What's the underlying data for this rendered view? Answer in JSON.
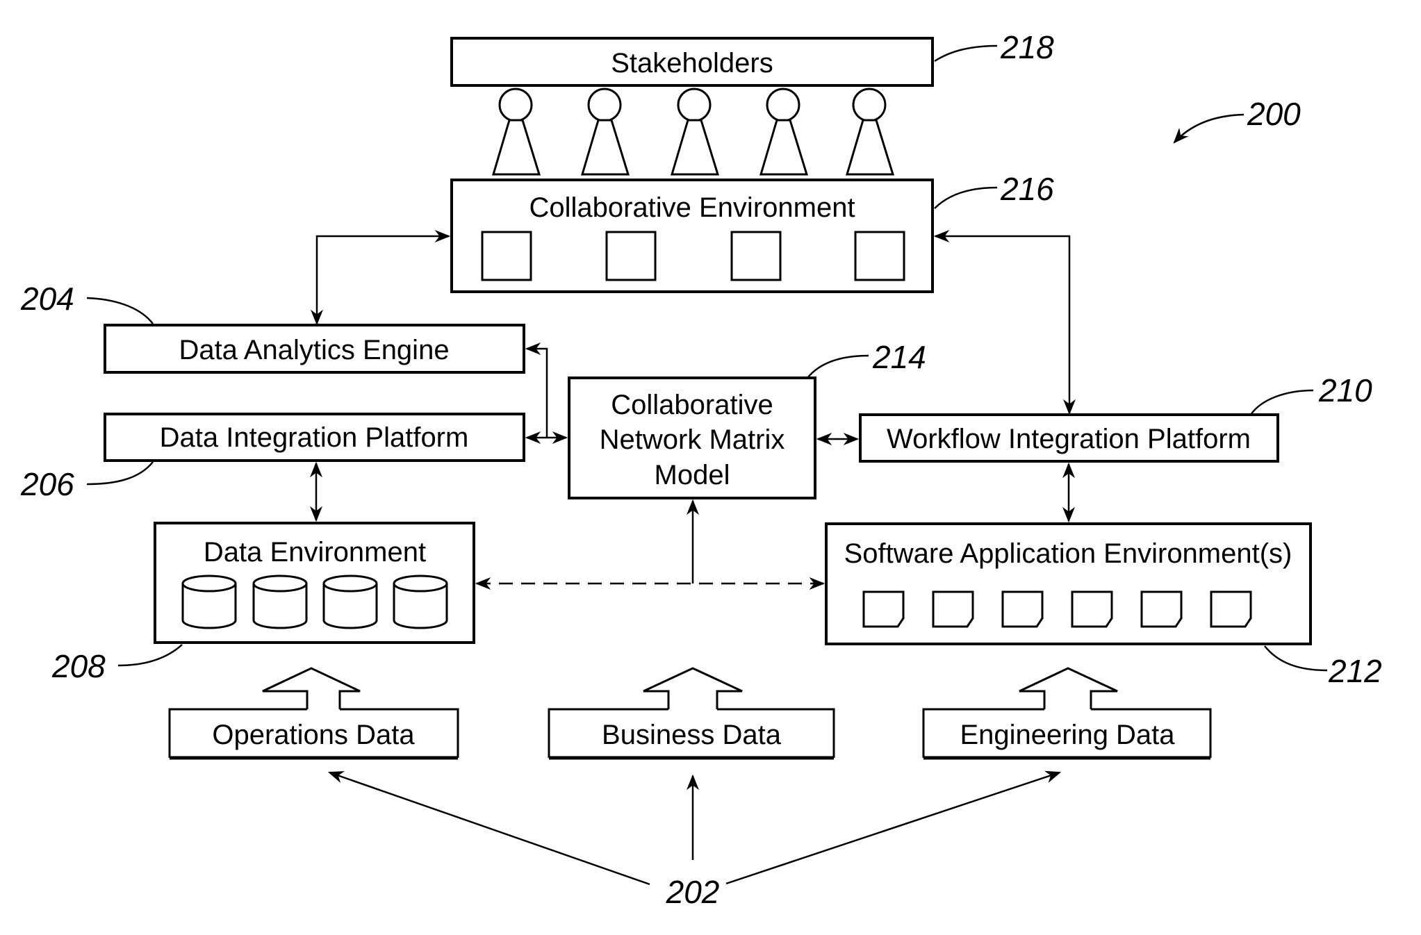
{
  "figure": {
    "reference": "200",
    "boxes": {
      "stakeholders": {
        "label": "Stakeholders",
        "ref": "218"
      },
      "collaborative_environment": {
        "label": "Collaborative Environment",
        "ref": "216"
      },
      "data_analytics_engine": {
        "label": "Data Analytics Engine",
        "ref": "204"
      },
      "data_integration_platform": {
        "label": "Data Integration Platform",
        "ref": "206"
      },
      "network_matrix_model": {
        "lines": [
          "Collaborative",
          "Network Matrix",
          "Model"
        ],
        "ref": "214"
      },
      "workflow_integration_platform": {
        "label": "Workflow Integration Platform",
        "ref": "210"
      },
      "data_environment": {
        "label": "Data Environment",
        "ref": "208"
      },
      "software_application_environment": {
        "label": "Software Application Environment(s)",
        "ref": "212"
      }
    },
    "data_sources": {
      "ref": "202",
      "items": [
        "Operations Data",
        "Business Data",
        "Engineering Data"
      ]
    },
    "icons": {
      "stakeholder_count": 5,
      "collab_square_count": 4,
      "database_count": 4,
      "document_count": 6
    }
  }
}
